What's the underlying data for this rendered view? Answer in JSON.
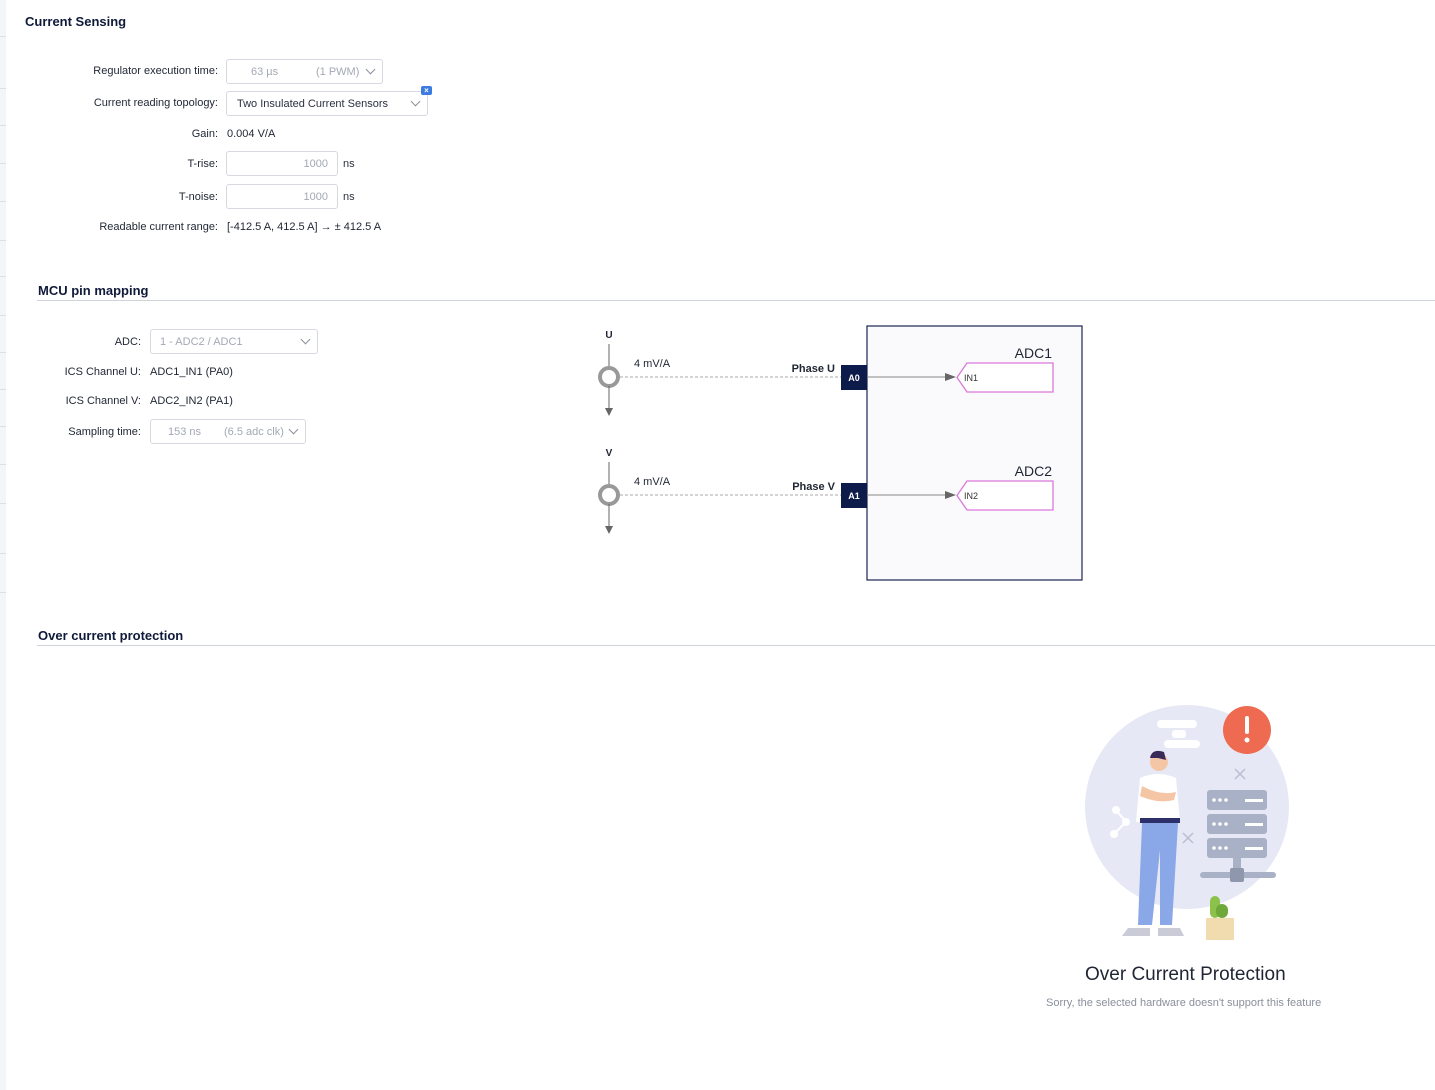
{
  "current_sensing": {
    "title": "Current Sensing",
    "regulator": {
      "label": "Regulator execution time:",
      "value": "63 µs",
      "suffix": "(1 PWM)"
    },
    "topology": {
      "label": "Current reading topology:",
      "value": "Two Insulated Current Sensors",
      "clear_icon": "clear-x-icon"
    },
    "gain": {
      "label": "Gain:",
      "value": "0.004 V/A"
    },
    "trise": {
      "label": "T-rise:",
      "value": "1000",
      "unit": "ns"
    },
    "tnoise": {
      "label": "T-noise:",
      "value": "1000",
      "unit": "ns"
    },
    "range": {
      "label": "Readable current range:",
      "value": "[-412.5 A, 412.5 A] → ± 412.5 A"
    }
  },
  "mcu_pin_mapping": {
    "title": "MCU pin mapping",
    "adc": {
      "label": "ADC:",
      "value": "1 - ADC2 / ADC1"
    },
    "ics_u": {
      "label": "ICS Channel U:",
      "value": "ADC1_IN1 (PA0)"
    },
    "ics_v": {
      "label": "ICS Channel V:",
      "value": "ADC2_IN2 (PA1)"
    },
    "sampling": {
      "label": "Sampling time:",
      "value": "153 ns",
      "suffix": "(6.5 adc clk)"
    },
    "diagram": {
      "phase_u": {
        "sensor": "U",
        "gain": "4 mV/A",
        "phase": "Phase U",
        "pin": "A0",
        "adc": "ADC1",
        "input": "IN1"
      },
      "phase_v": {
        "sensor": "V",
        "gain": "4 mV/A",
        "phase": "Phase V",
        "pin": "A1",
        "adc": "ADC2",
        "input": "IN2"
      },
      "colors": {
        "pin_fill": "#0d1b4b",
        "input_stroke": "#d978d9",
        "mcu_border": "#1a2350",
        "mcu_fill": "#fafafd"
      }
    }
  },
  "over_current": {
    "title": "Over current protection",
    "empty_title": "Over Current Protection",
    "empty_message": "Sorry, the selected hardware doesn't support this feature",
    "colors": {
      "alert": "#ee6a50",
      "circle": "#e6e9f5",
      "server": "#a9b1c6"
    }
  }
}
